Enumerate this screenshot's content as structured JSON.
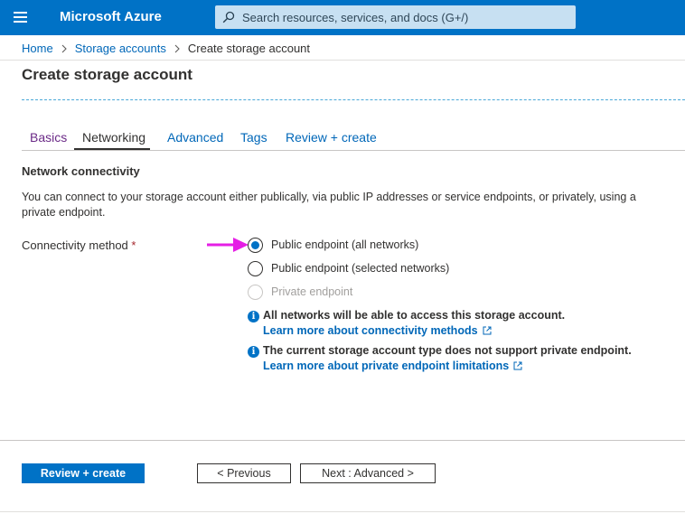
{
  "topbar": {
    "brand": "Microsoft Azure",
    "search_placeholder": "Search resources, services, and docs (G+/)"
  },
  "breadcrumb": {
    "items": [
      "Home",
      "Storage accounts"
    ],
    "current": "Create storage account"
  },
  "page": {
    "title": "Create storage account"
  },
  "tabs": [
    {
      "label": "Basics",
      "state": "visited"
    },
    {
      "label": "Networking",
      "state": "active"
    },
    {
      "label": "Advanced",
      "state": "link"
    },
    {
      "label": "Tags",
      "state": "link"
    },
    {
      "label": "Review + create",
      "state": "link"
    }
  ],
  "network": {
    "heading": "Network connectivity",
    "description": "You can connect to your storage account either publically, via public IP addresses or service endpoints, or privately, using a private endpoint.",
    "field_label": "Connectivity method",
    "required_marker": "*",
    "options": [
      {
        "label": "Public endpoint (all networks)",
        "selected": true,
        "disabled": false
      },
      {
        "label": "Public endpoint (selected networks)",
        "selected": false,
        "disabled": false
      },
      {
        "label": "Private endpoint",
        "selected": false,
        "disabled": true
      }
    ],
    "info": [
      {
        "text": "All networks will be able to access this storage account.",
        "link": "Learn more about connectivity methods"
      },
      {
        "text": "The current storage account type does not support private endpoint.",
        "link": "Learn more about private endpoint limitations"
      }
    ]
  },
  "footer": {
    "review_button": "Review + create",
    "previous_button": "< Previous",
    "next_button": "Next : Advanced >"
  },
  "colors": {
    "azure_blue": "#0072c6",
    "link_blue": "#0067b8",
    "visited_purple": "#6b2a87",
    "required_red": "#a4262c",
    "annotation_arrow": "#e51ee5"
  },
  "icons": {
    "menu": "hamburger-menu-icon",
    "search": "search-icon",
    "breadcrumb_separator": "chevron-right-icon",
    "info": "info-icon",
    "external_link": "external-link-icon",
    "annotation": "pointer-arrow-icon"
  }
}
